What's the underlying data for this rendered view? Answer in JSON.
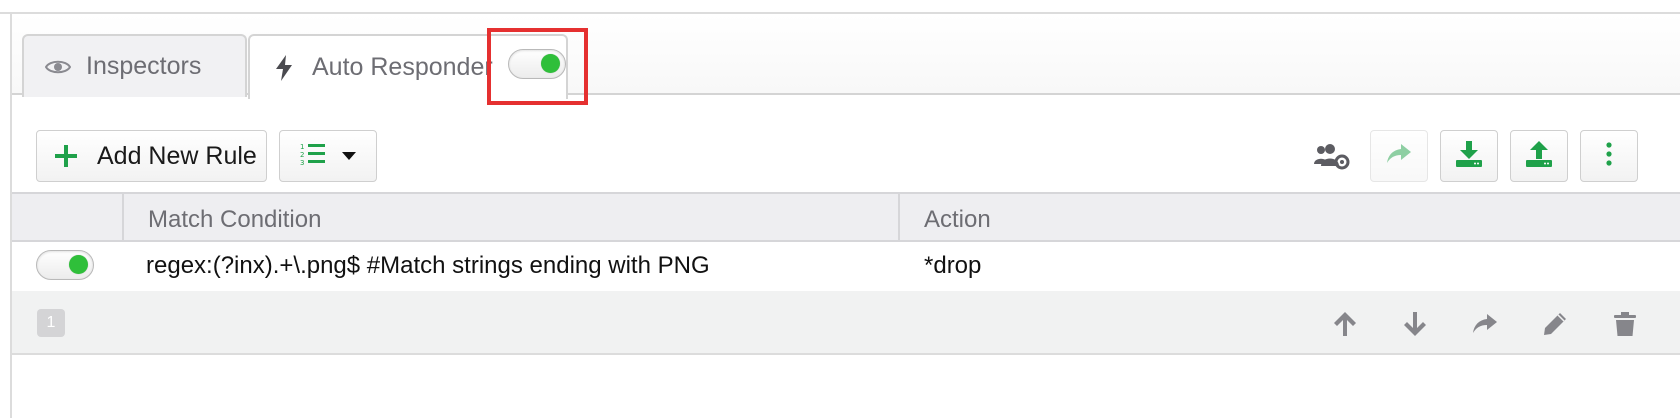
{
  "tabs": [
    {
      "label": "Inspectors",
      "icon": "eye-icon",
      "active": false
    },
    {
      "label": "Auto Responder",
      "icon": "lightning-icon",
      "active": true,
      "enabled": true
    }
  ],
  "toolbar": {
    "add_rule_label": "Add New Rule",
    "list_icon": "numbered-list-icon",
    "right_icons": [
      "team-settings-icon",
      "share-icon",
      "import-icon",
      "export-icon",
      "more-vertical-icon"
    ]
  },
  "table": {
    "columns": [
      "Match Condition",
      "Action"
    ],
    "rows": [
      {
        "enabled": true,
        "match": "regex:(?inx).+\\.png$ #Match strings ending with PNG",
        "action": "*drop"
      }
    ],
    "row_number": "1",
    "row_actions": [
      "arrow-up-icon",
      "arrow-down-icon",
      "share-icon",
      "pencil-icon",
      "trash-icon"
    ]
  },
  "colors": {
    "accent_green": "#2fbf3a",
    "icon_green": "#1fa14a",
    "highlight_red": "#e53030",
    "muted_gray": "#6d6d73"
  }
}
